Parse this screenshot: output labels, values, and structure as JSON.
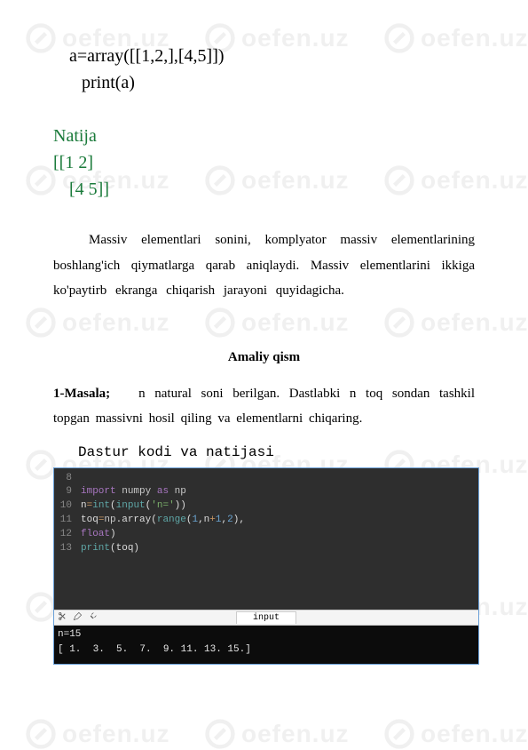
{
  "watermark": "oefen.uz",
  "code_example": {
    "line1": "a=array([[1,2,],[4,5]])",
    "line2": "print(a)"
  },
  "natija": {
    "title": "Natija",
    "row1": "[[1 2]",
    "row2": "[4 5]]"
  },
  "paragraph": "Massiv elementlari sonini, komplyator massiv elementlarining boshlang'ich qiymatlarga qarab aniqlaydi. Massiv elementlarini ikkiga ko'paytirb ekranga chiqarish jarayoni quyidagicha.",
  "amaliy_heading": "Amaliy qism",
  "masala": {
    "label": "1-Masala;",
    "text": "n natural soni berilgan. Dastlabki n toq sondan tashkil topgan massivni hosil qiling va elementlarni chiqaring."
  },
  "dastur_heading": "Dastur kodi va natijasi",
  "editor": {
    "lines": [
      {
        "n": "8",
        "tokens": []
      },
      {
        "n": "9",
        "tokens": [
          [
            "kw",
            "import"
          ],
          [
            " ",
            " "
          ],
          [
            "mod",
            "numpy"
          ],
          [
            " ",
            " "
          ],
          [
            "as",
            "as"
          ],
          [
            " ",
            " "
          ],
          [
            "mod",
            "np"
          ]
        ]
      },
      {
        "n": "10",
        "tokens": [
          [
            "",
            "n"
          ],
          [
            "op",
            "="
          ],
          [
            "fn",
            "int"
          ],
          [
            "",
            "("
          ],
          [
            "fn",
            "input"
          ],
          [
            "",
            "("
          ],
          [
            "str",
            "'n='"
          ],
          [
            "",
            ")"
          ],
          [
            "",
            ")"
          ]
        ]
      },
      {
        "n": "11",
        "tokens": [
          [
            "",
            "toq"
          ],
          [
            "op",
            "="
          ],
          [
            "mod",
            "np"
          ],
          [
            "",
            ".array("
          ],
          [
            "fn",
            "range"
          ],
          [
            "",
            "("
          ],
          [
            "num",
            "1"
          ],
          [
            "",
            ",n"
          ],
          [
            "op",
            "+"
          ],
          [
            "num",
            "1"
          ],
          [
            "",
            ","
          ],
          [
            "num",
            "2"
          ],
          [
            "",
            ")"
          ],
          [
            "",
            ","
          ]
        ]
      },
      {
        "n": "12",
        "tokens": [
          [
            "kwf",
            "float"
          ],
          [
            "",
            ")"
          ]
        ]
      },
      {
        "n": "13",
        "tokens": [
          [
            "pr",
            "print"
          ],
          [
            "",
            "(toq)"
          ]
        ]
      }
    ]
  },
  "toolbar_tab": "input",
  "console": {
    "prompt": "n=15",
    "output": "[ 1.  3.  5.  7.  9. 11. 13. 15.]"
  }
}
